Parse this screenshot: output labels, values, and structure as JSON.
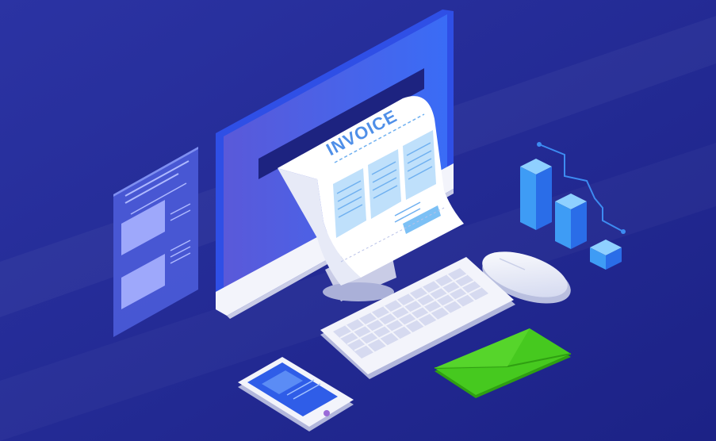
{
  "invoice": {
    "title": "INVOICE"
  },
  "colors": {
    "background": "#232a95",
    "monitor_blue": "#3d5cf2",
    "paper": "#ffffff",
    "invoice_accent": "#5aa6ef",
    "chart_blue": "#3e8cf3",
    "envelope_green": "#3bc318",
    "phone_screen": "#2f5de8"
  },
  "icons": {
    "document_panel": "document-icon",
    "bar_chart": "bar-chart-icon",
    "envelope": "envelope-icon",
    "mouse": "mouse-icon",
    "keyboard": "keyboard-icon",
    "smartphone": "smartphone-icon",
    "monitor": "monitor-icon"
  }
}
